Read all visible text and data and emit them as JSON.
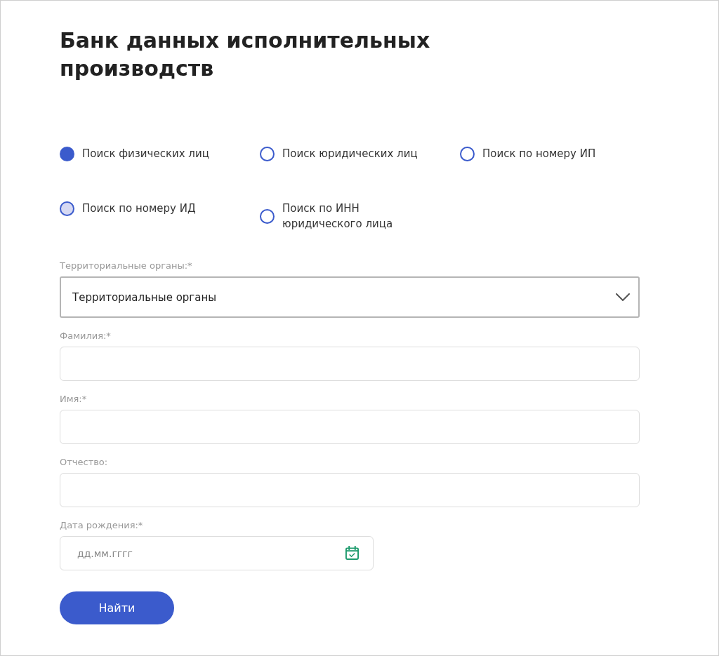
{
  "title": "Банк данных исполнительных производств",
  "search_types": [
    {
      "label": "Поиск физических лиц",
      "selected": true,
      "hovered": false
    },
    {
      "label": "Поиск юридических лиц",
      "selected": false,
      "hovered": false
    },
    {
      "label": "Поиск по номеру ИП",
      "selected": false,
      "hovered": false
    },
    {
      "label": "Поиск по номеру ИД",
      "selected": false,
      "hovered": true
    },
    {
      "label": "Поиск по ИНН юридического лица",
      "selected": false,
      "hovered": false
    }
  ],
  "fields": [
    {
      "kind": "select",
      "label": "Территориальные органы:*",
      "value": "Территориальные органы"
    },
    {
      "kind": "text",
      "label": "Фамилия:*"
    },
    {
      "kind": "text",
      "label": "Имя:*"
    },
    {
      "kind": "text",
      "label": "Отчество:"
    },
    {
      "kind": "date",
      "label": "Дата рождения:*",
      "placeholder": "дд.мм.гггг"
    }
  ],
  "submit_button": "Найти"
}
